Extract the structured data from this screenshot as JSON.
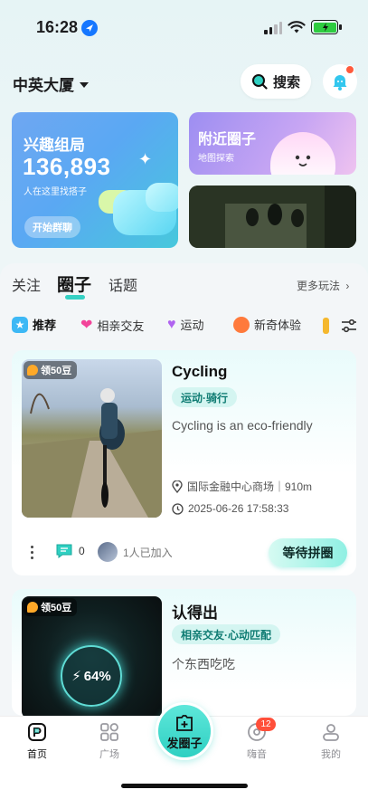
{
  "status_bar": {
    "time": "16:28"
  },
  "header": {
    "location": "中英大厦",
    "search_label": "搜索"
  },
  "interest_card": {
    "title": "兴趣组局",
    "count": "136,893",
    "subtitle": "人在这里找搭子",
    "button": "开始群聊"
  },
  "nearby_card": {
    "title": "附近圈子",
    "subtitle": "地图探索"
  },
  "tabs": {
    "items": [
      "关注",
      "圈子",
      "话题"
    ],
    "active": "圈子",
    "more": "更多玩法"
  },
  "categories": [
    {
      "label": "推荐",
      "icon": "star-icon",
      "color": "#3db8f5"
    },
    {
      "label": "相亲交友",
      "icon": "hearts-icon",
      "color": "#f2449a"
    },
    {
      "label": "运动",
      "icon": "heartbeat-icon",
      "color": "#b063f0"
    },
    {
      "label": "新奇体验",
      "icon": "planet-icon",
      "color": "#ff7a3c"
    }
  ],
  "cards": [
    {
      "badge": "领50豆",
      "title": "Cycling",
      "tag": "运动·骑行",
      "description": "Cycling is an eco-friendly",
      "location": "国际金融中心商场｜910m",
      "datetime": "2025-06-26 17:58:33",
      "comments": "0",
      "joined": "1人已加入",
      "action": "等待拼圈"
    },
    {
      "badge": "领50豆",
      "title": "认得出",
      "tag": "相亲交友·心动匹配",
      "description": "个东西吃吃",
      "progress_label": "64%"
    }
  ],
  "tabbar": {
    "items": [
      "首页",
      "广场",
      "发圈子",
      "嗨音",
      "我的"
    ],
    "badge": "12",
    "accent": "#2fd0c2"
  }
}
